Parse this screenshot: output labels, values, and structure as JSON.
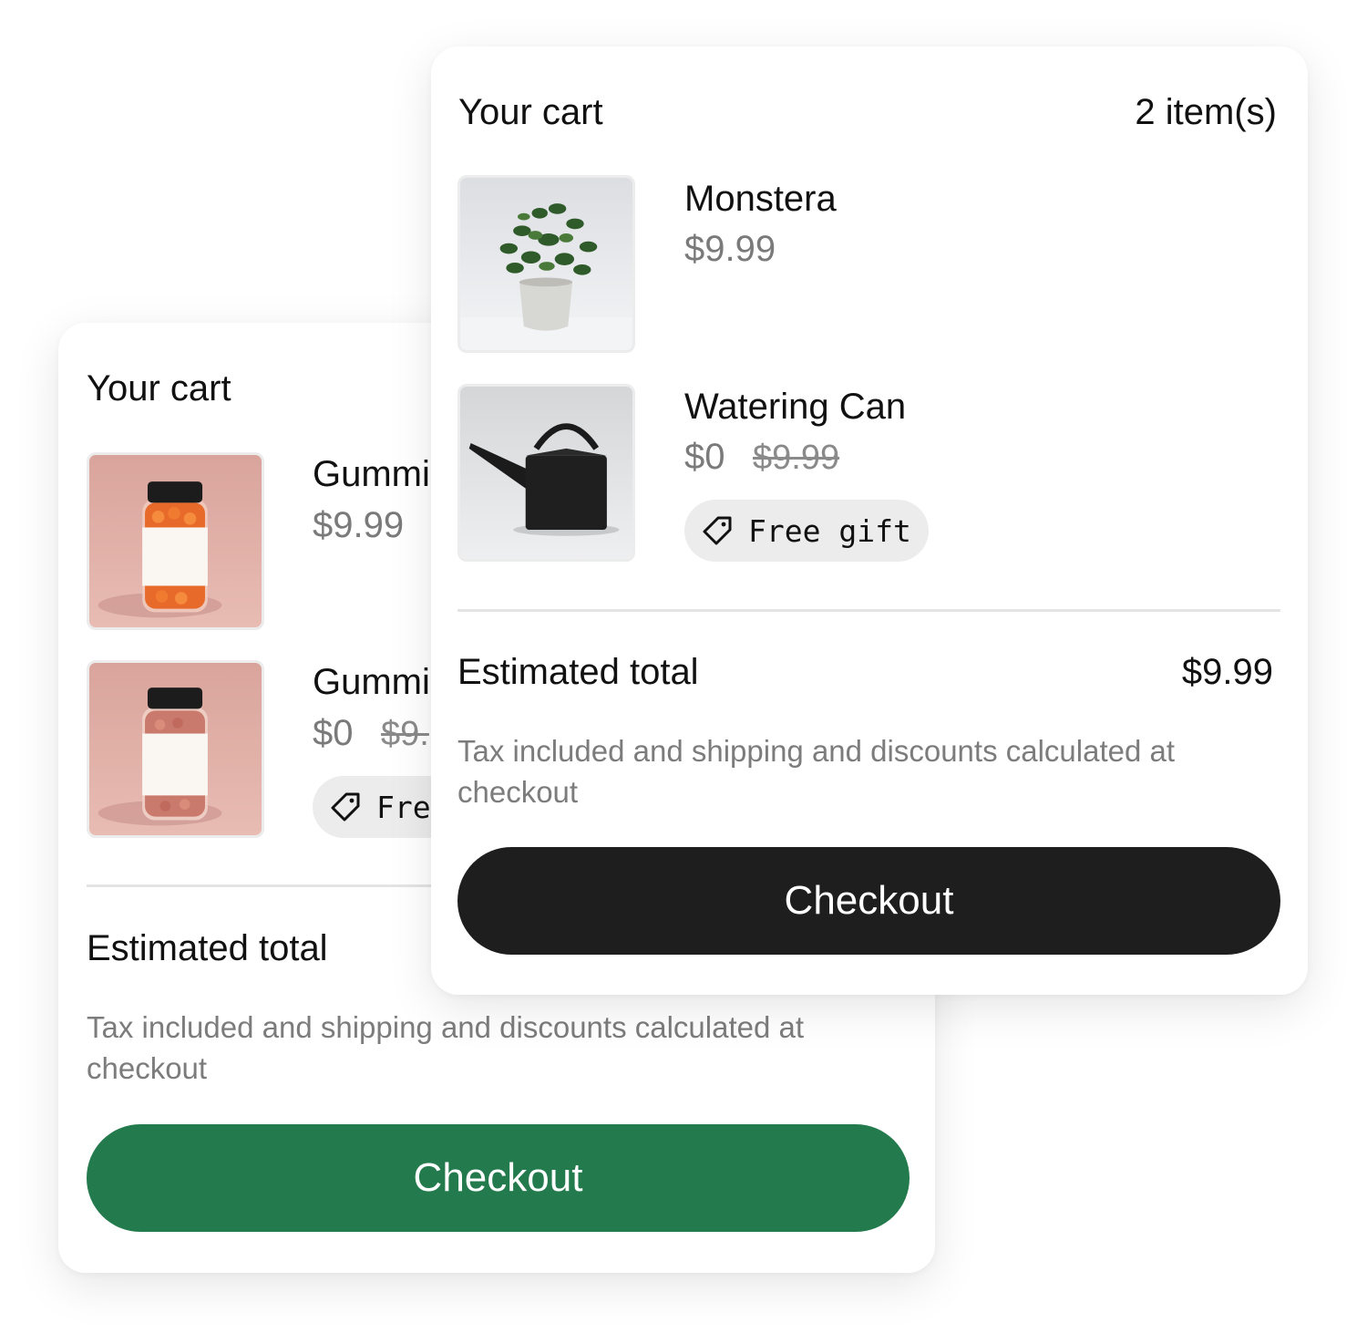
{
  "back_cart": {
    "title": "Your cart",
    "items": [
      {
        "name": "Gummi",
        "price": "$9.99",
        "image": "orange-gummies-jar"
      },
      {
        "name": "Gummi",
        "price": "$0",
        "original_price": "$9.",
        "badge": "Fre",
        "badge_icon": "tag-icon",
        "image": "red-gummies-jar"
      }
    ],
    "total_label": "Estimated total",
    "tax_note": "Tax included and shipping and discounts calculated at checkout",
    "checkout_label": "Checkout",
    "accent_color": "#237a4c"
  },
  "front_cart": {
    "title": "Your cart",
    "item_count": "2 item(s)",
    "items": [
      {
        "name": "Monstera",
        "price": "$9.99",
        "image": "potted-plant"
      },
      {
        "name": "Watering Can",
        "price": "$0",
        "original_price": "$9.99",
        "badge": "Free gift",
        "badge_icon": "tag-icon",
        "image": "black-watering-can"
      }
    ],
    "total_label": "Estimated total",
    "total_value": "$9.99",
    "tax_note": "Tax included and shipping and discounts calculated at checkout",
    "checkout_label": "Checkout",
    "accent_color": "#1e1e1e"
  }
}
